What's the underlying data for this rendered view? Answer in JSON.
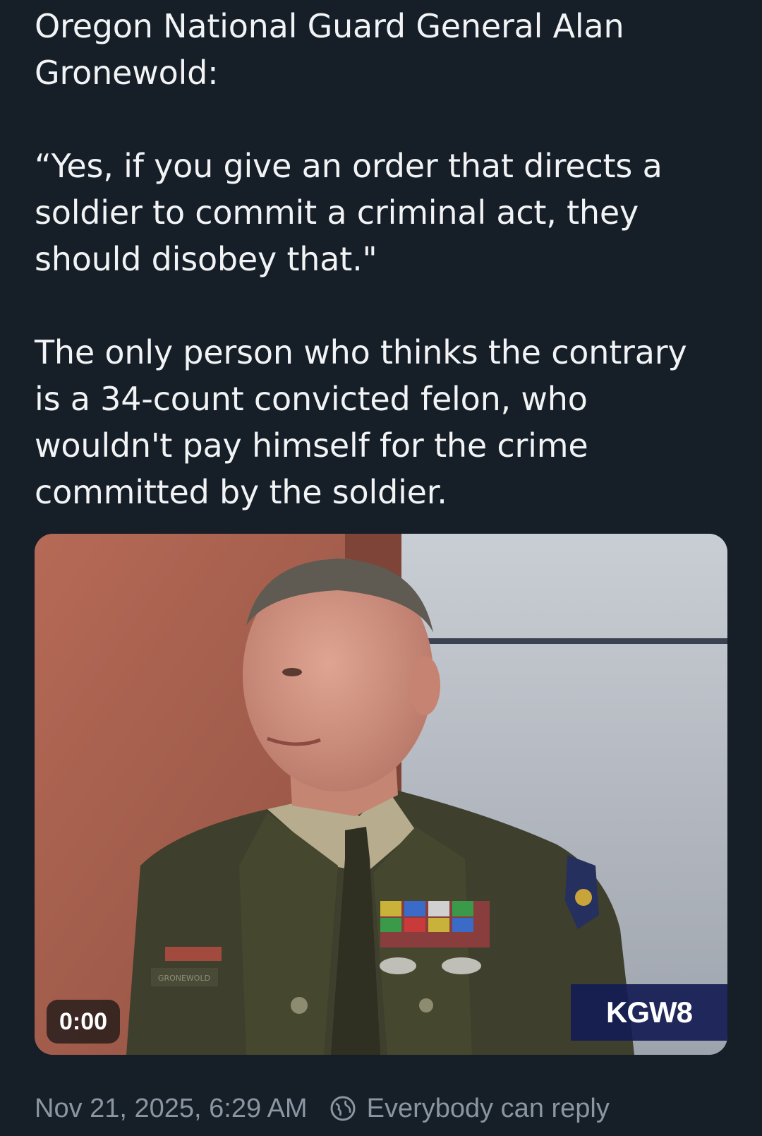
{
  "post": {
    "paragraphs": [
      "Oregon National Guard General Alan\nGronewold:",
      "“Yes, if you give an order that directs a\nsoldier to commit a criminal act, they\nshould disobey that.\"",
      "The only person who thinks the contrary\nis a 34-count convicted felon, who\nwouldn't pay himself for the crime\ncommitted by the soldier."
    ]
  },
  "video": {
    "timestamp": "0:00",
    "station_logo": "KGW8",
    "nametag": "GRONEWOLD"
  },
  "meta": {
    "posted_at": "Nov 21, 2025, 6:29 AM",
    "reply_setting_icon": "globe-icon",
    "reply_setting": "Everybody can reply"
  },
  "colors": {
    "background": "#161e27",
    "text": "#f1f3f5",
    "muted": "#8b96a3",
    "uniform": "#3e3f2c",
    "wall": "#a45e4c"
  }
}
